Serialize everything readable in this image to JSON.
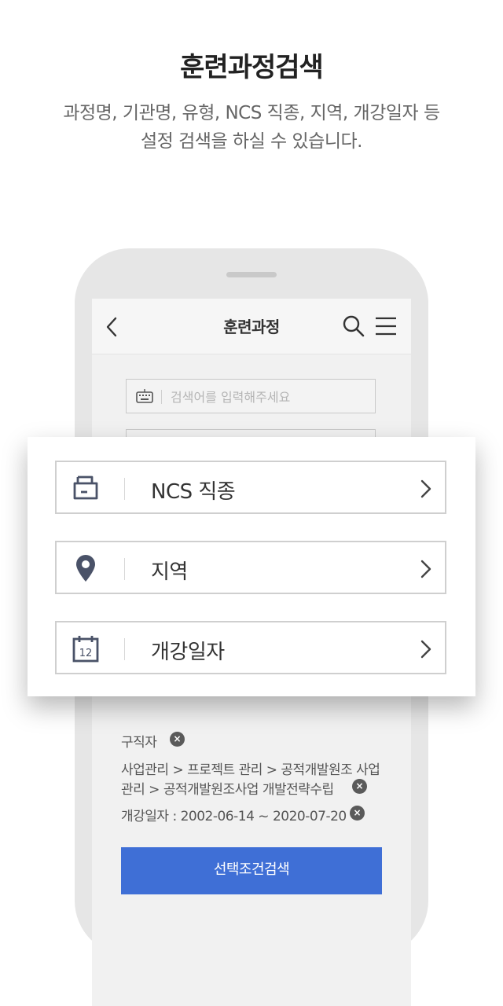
{
  "intro": {
    "title": "훈련과정검색",
    "subtitle_line1": "과정명, 기관명, 유형, NCS 직종, 지역, 개강일자 등",
    "subtitle_line2": "설정 검색을 하실 수 있습니다."
  },
  "appbar": {
    "title": "훈련과정",
    "back_icon": "chevron-left-icon",
    "search_icon": "search-icon",
    "menu_icon": "hamburger-menu-icon"
  },
  "search": {
    "placeholder": "검색어를 입력해주세요",
    "icon": "keyboard-icon"
  },
  "options": [
    {
      "label": "NCS 직종",
      "icon": "folder-icon"
    },
    {
      "label": "지역",
      "icon": "location-pin-icon"
    },
    {
      "label": "개강일자",
      "icon": "calendar-icon",
      "icon_text": "12"
    }
  ],
  "filters": {
    "job_seeker": "구직자",
    "ncs_line1": "사업관리 > 프로젝트 관리 > 공적개발원조 사업",
    "ncs_line2": "관리 > 공적개발원조사업 개발전략수립",
    "date": "개강일자 : 2002-06-14 ~ 2020-07-20",
    "clear_symbol": "×"
  },
  "submit_label": "선택조건검색",
  "colors": {
    "accent": "#3f6fd6",
    "icon": "#4a5268",
    "phone_frame": "#e6e6e6"
  }
}
